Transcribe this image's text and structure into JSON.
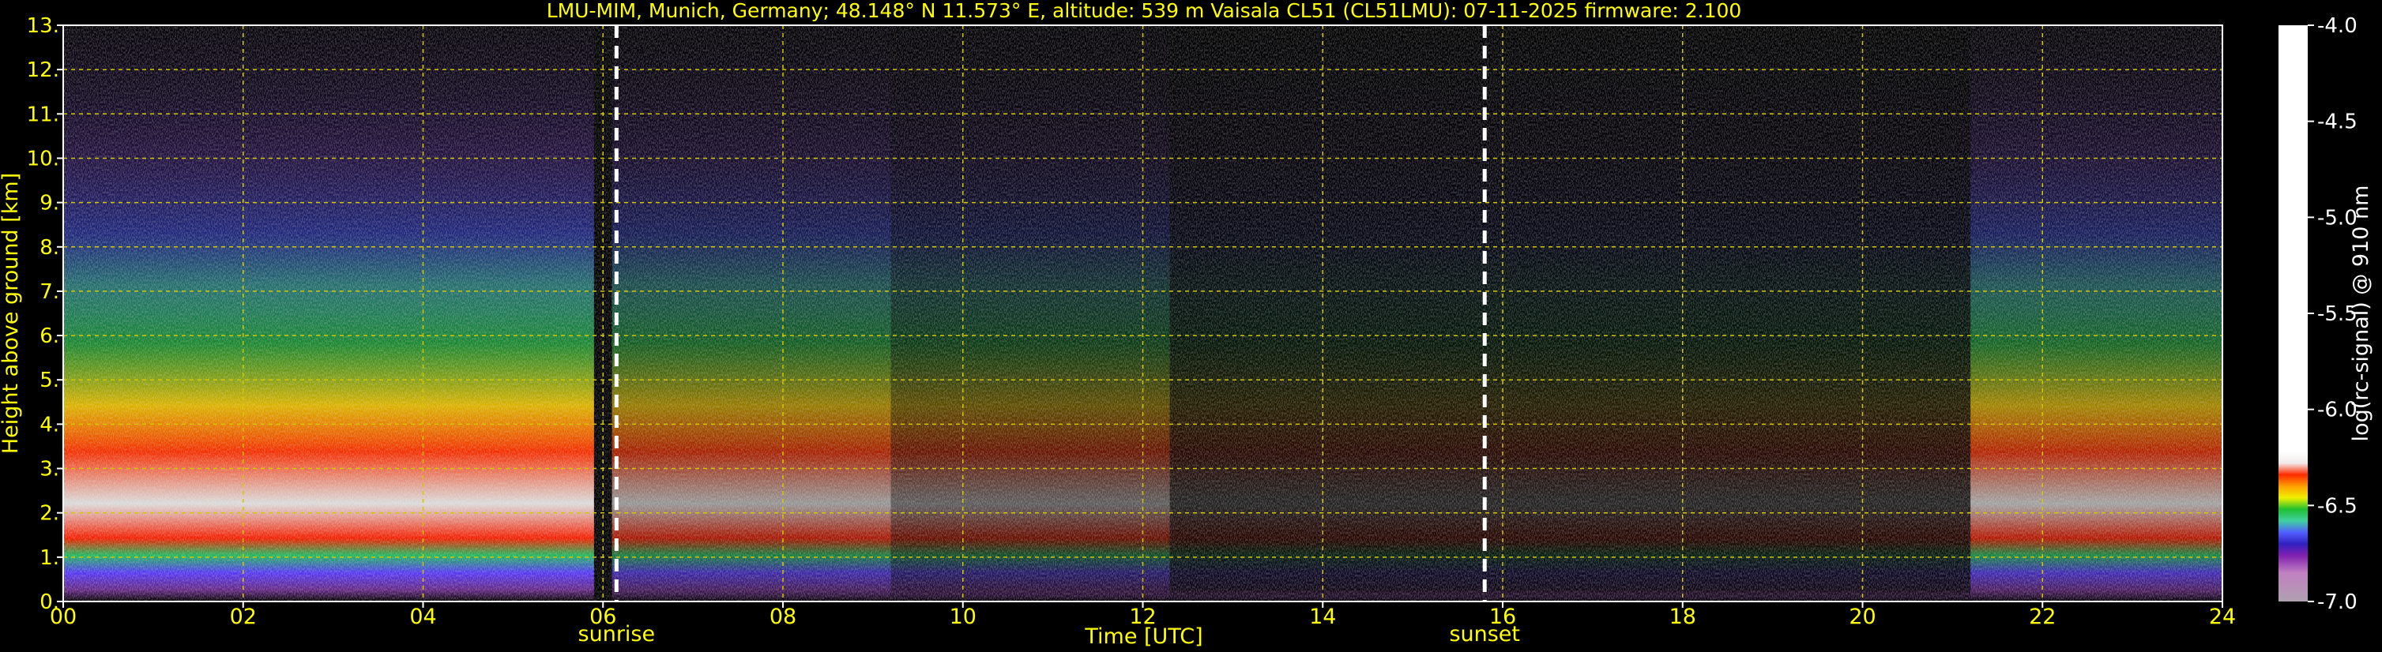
{
  "chart_data": {
    "type": "heatmap",
    "title": "LMU-MIM, Munich, Germany; 48.148° N 11.573° E, altitude: 539 m    Vaisala CL51 (CL51LMU): 07-11-2025    firmware: 2.100",
    "xlabel": "Time [UTC]",
    "ylabel": "Height above ground [km]",
    "xlim": [
      0,
      24
    ],
    "ylim": [
      0,
      13
    ],
    "x_ticks": [
      "00",
      "02",
      "04",
      "06",
      "08",
      "10",
      "12",
      "14",
      "16",
      "18",
      "20",
      "22",
      "24"
    ],
    "y_ticks": [
      "0.",
      "1.",
      "2.",
      "3.",
      "4.",
      "5.",
      "6.",
      "7.",
      "8.",
      "9.",
      "10.",
      "11.",
      "12.",
      "13."
    ],
    "grid": true,
    "events": [
      {
        "label": "sunrise",
        "time": 6.15
      },
      {
        "label": "sunset",
        "time": 15.8
      }
    ],
    "colorbar": {
      "label": "log(rc-signal) @ 910 nm",
      "range": [
        -7.0,
        -4.0
      ],
      "ticks": [
        "-4.0",
        "-4.5",
        "-5.0",
        "-5.5",
        "-6.0",
        "-6.5",
        "-7.0"
      ]
    },
    "segments": [
      {
        "start": 0.0,
        "end": 5.9,
        "level": 0.95
      },
      {
        "start": 6.1,
        "end": 9.2,
        "level": 0.65
      },
      {
        "start": 9.2,
        "end": 12.3,
        "level": 0.4
      },
      {
        "start": 12.3,
        "end": 21.2,
        "level": 0.15
      },
      {
        "start": 21.2,
        "end": 24.0,
        "level": 0.7
      }
    ]
  },
  "colors": {
    "text": "#ffff00",
    "grid": "#d4c800",
    "background": "#000000",
    "event_line": "#ffffff"
  }
}
